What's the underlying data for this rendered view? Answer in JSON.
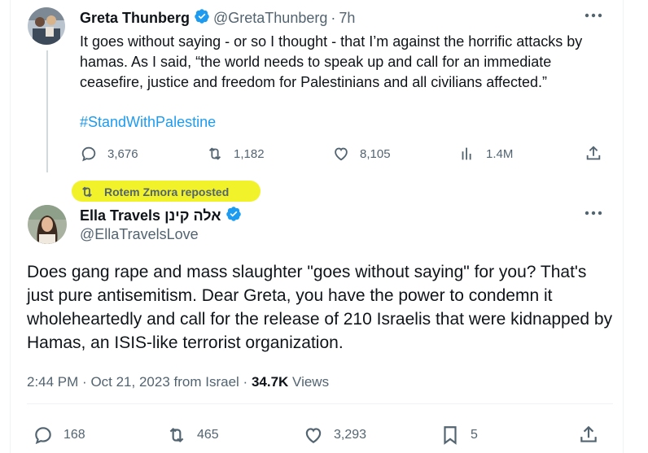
{
  "quoted_tweet": {
    "author_name": "Greta Thunberg",
    "handle": "@GretaThunberg",
    "time": "7h",
    "text": "It goes without saying - or so I thought - that I’m against the horrific attacks by hamas. As I said, “the world needs to speak up and call for an immediate ceasefire, justice and freedom for Palestinians and all civilians affected.”",
    "hashtag": "#StandWithPalestine",
    "replies": "3,676",
    "reposts": "1,182",
    "likes": "8,105",
    "views": "1.4M"
  },
  "repost_label": "Rotem Zmora reposted",
  "main_tweet": {
    "author_name": "Ella Travels אלה קינן",
    "handle": "@EllaTravelsLove",
    "text": "Does gang rape and mass slaughter \"goes without saying\" for you? That's just pure antisemitism. Dear Greta, you have the power to condemn it wholeheartedly and call for the release of 210 Israelis that were kidnapped by Hamas, an ISIS-like terrorist organization.",
    "time": "2:44 PM",
    "date": "Oct 21, 2023",
    "location": "from Israel",
    "views_count": "34.7K",
    "views_label": "Views",
    "replies": "168",
    "reposts": "465",
    "likes": "3,293",
    "bookmarks": "5"
  },
  "colors": {
    "accent": "#1d9bf0",
    "muted": "#536471",
    "highlight": "#f2f22b"
  },
  "icons": [
    "verified-badge-icon",
    "more-icon",
    "reply-icon",
    "repost-icon",
    "like-icon",
    "views-icon",
    "share-icon",
    "bookmark-icon"
  ]
}
